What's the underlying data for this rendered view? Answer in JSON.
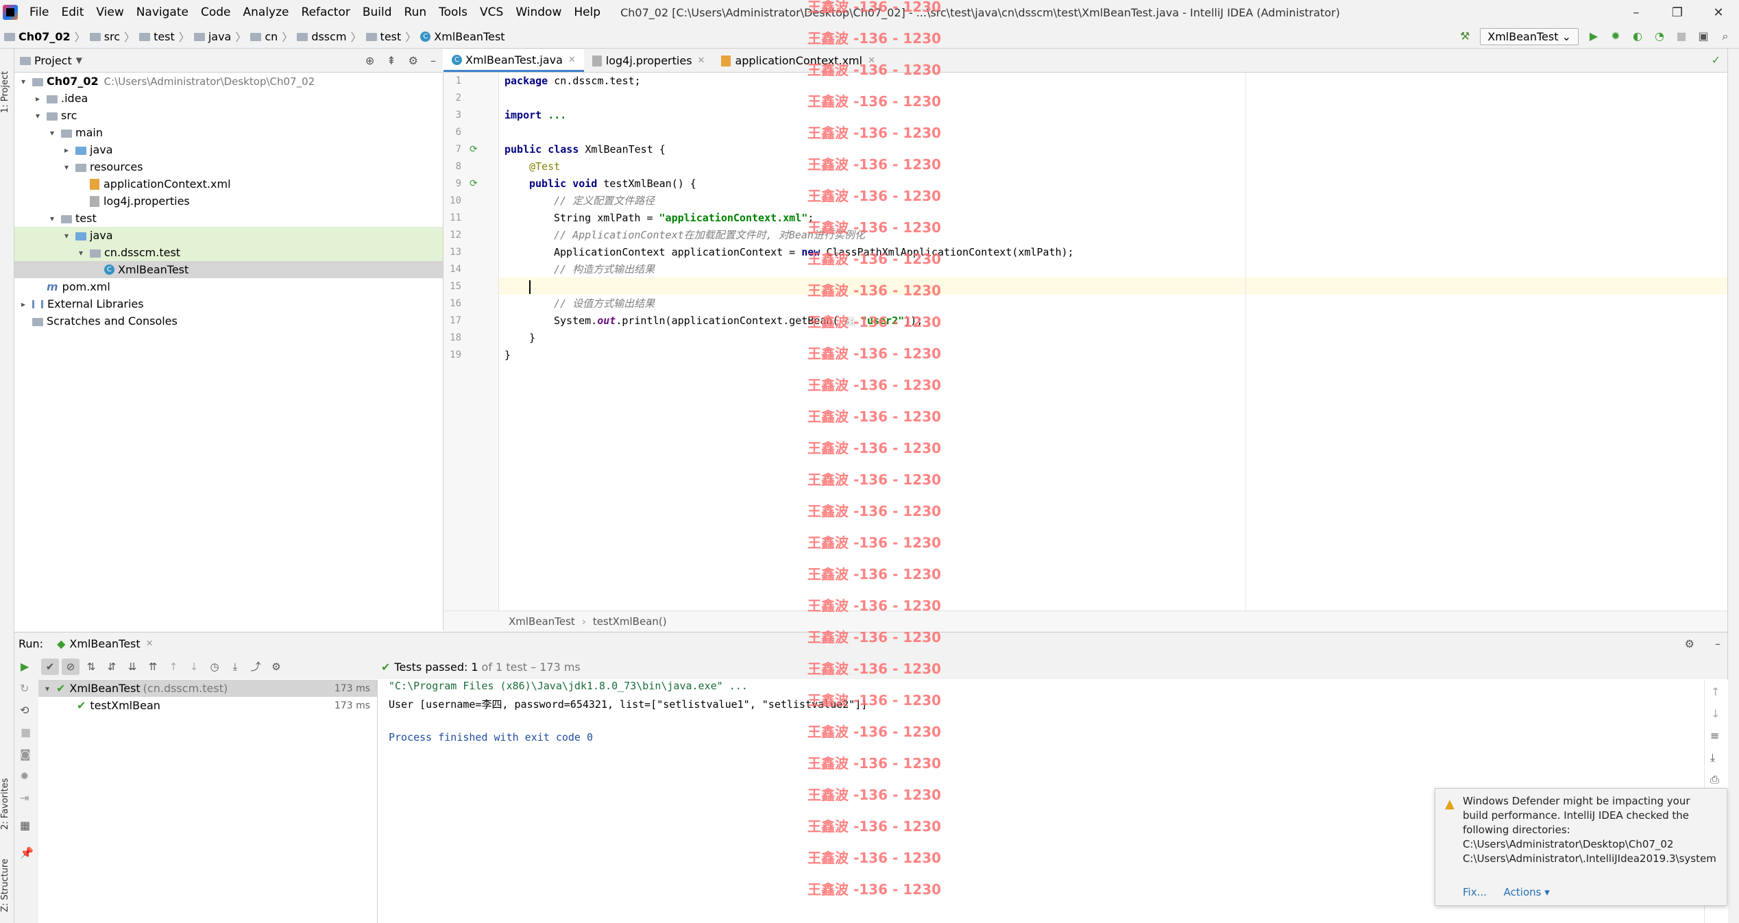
{
  "menubar": {
    "items": [
      "File",
      "Edit",
      "View",
      "Navigate",
      "Code",
      "Analyze",
      "Refactor",
      "Build",
      "Run",
      "Tools",
      "VCS",
      "Window",
      "Help"
    ],
    "window_title": "Ch07_02 [C:\\Users\\Administrator\\Desktop\\Ch07_02] - ...\\src\\test\\java\\cn\\dsscm\\test\\XmlBeanTest.java - IntelliJ IDEA (Administrator)",
    "controls": [
      "–",
      "❐",
      "✕"
    ]
  },
  "navbar": {
    "crumbs": [
      "Ch07_02",
      "src",
      "test",
      "java",
      "cn",
      "dsscm",
      "test",
      "XmlBeanTest"
    ],
    "run_config": "XmlBeanTest"
  },
  "left_stripe": {
    "project": "1: Project",
    "favorites": "2: Favorites",
    "structure": "Z: Structure"
  },
  "project_panel": {
    "title": "Project",
    "tree": [
      {
        "label": "Ch07_02",
        "extra": "C:\\Users\\Administrator\\Desktop\\Ch07_02",
        "depth": 0,
        "arrow": "▾",
        "icon": "folder",
        "bold": true
      },
      {
        "label": ".idea",
        "depth": 1,
        "arrow": "▸",
        "icon": "folder"
      },
      {
        "label": "src",
        "depth": 1,
        "arrow": "▾",
        "icon": "folder"
      },
      {
        "label": "main",
        "depth": 2,
        "arrow": "▾",
        "icon": "folder"
      },
      {
        "label": "java",
        "depth": 3,
        "arrow": "▸",
        "icon": "folder-blue"
      },
      {
        "label": "resources",
        "depth": 3,
        "arrow": "▾",
        "icon": "folder"
      },
      {
        "label": "applicationContext.xml",
        "depth": 4,
        "arrow": "",
        "icon": "xml"
      },
      {
        "label": "log4j.properties",
        "depth": 4,
        "arrow": "",
        "icon": "properties"
      },
      {
        "label": "test",
        "depth": 2,
        "arrow": "▾",
        "icon": "folder"
      },
      {
        "label": "java",
        "depth": 3,
        "arrow": "▾",
        "icon": "folder-blue",
        "state": "hl"
      },
      {
        "label": "cn.dsscm.test",
        "depth": 4,
        "arrow": "▾",
        "icon": "folder",
        "state": "hl"
      },
      {
        "label": "XmlBeanTest",
        "depth": 5,
        "arrow": "",
        "icon": "class",
        "state": "sel"
      },
      {
        "label": "pom.xml",
        "depth": 1,
        "arrow": "",
        "icon": "maven"
      },
      {
        "label": "External Libraries",
        "depth": 0,
        "arrow": "▸",
        "icon": "library"
      },
      {
        "label": "Scratches and Consoles",
        "depth": 0,
        "arrow": "",
        "icon": "scratch"
      }
    ]
  },
  "editor": {
    "tabs": [
      {
        "label": "XmlBeanTest.java",
        "active": true
      },
      {
        "label": "log4j.properties",
        "active": false
      },
      {
        "label": "applicationContext.xml",
        "active": false
      }
    ],
    "line_numbers": [
      "1",
      "2",
      "3",
      "6",
      "7",
      "8",
      "9",
      "10",
      "11",
      "12",
      "13",
      "14",
      "15",
      "16",
      "17",
      "18",
      "19"
    ],
    "code": {
      "l1_kw": "package",
      "l1_rest": " cn.dsscm.test;",
      "l3_kw": "import",
      "l3_rest": " ...",
      "l7_kw": "public class",
      "l7_rest": " XmlBeanTest {",
      "l8_an": "@Test",
      "l9_kw": "public void",
      "l9_rest": " testXmlBean() {",
      "l10_cm": "// 定义配置文件路径",
      "l11_a": "String xmlPath = ",
      "l11_str": "\"applicationContext.xml\"",
      "l11_b": ";",
      "l12_cm": "// ApplicationContext在加载配置文件时, 对Bean进行实例化",
      "l13_a": "ApplicationContext applicationContext = ",
      "l13_kw": "new",
      "l13_b": " ClassPathXmlApplicationContext(xmlPath);",
      "l14_cm": "// 构造方式输出结果",
      "l16_cm": "// 设值方式输出结果",
      "l17_a": "System.",
      "l17_fld": "out",
      "l17_b": ".println(applicationContext.getBean( ",
      "l17_hint": "s:",
      "l17_str": " \"user2\"",
      "l17_c": "));",
      "l18": "}",
      "l19": "}"
    },
    "breadcrumb": [
      "XmlBeanTest",
      "testXmlBean()"
    ]
  },
  "run": {
    "label": "Run:",
    "tab": "XmlBeanTest",
    "status_bold": "Tests passed:",
    "status_count": "1",
    "status_rest": "of 1 test – 173 ms",
    "tree": [
      {
        "label": "XmlBeanTest",
        "extra": "(cn.dsscm.test)",
        "ms": "173 ms"
      },
      {
        "label": "testXmlBean",
        "extra": "",
        "ms": "173 ms"
      }
    ],
    "console": [
      "\"C:\\Program Files (x86)\\Java\\jdk1.8.0_73\\bin\\java.exe\" ...",
      "User [username=李四, password=654321, list=[\"setlistvalue1\", \"setlistvalue2\"]]",
      "",
      "Process finished with exit code 0"
    ]
  },
  "notification": {
    "message": "Windows Defender might be impacting your build performance. IntelliJ IDEA checked the following directories:",
    "dir1": "C:\\Users\\Administrator\\Desktop\\Ch07_02",
    "dir2": "C:\\Users\\Administrator\\.IntelliJIdea2019.3\\system",
    "fix": "Fix...",
    "actions": "Actions ▾"
  },
  "watermark": "王鑫波 -136 - 1230",
  "colors": {
    "accent": "#4083c9",
    "pass": "#3f9c35",
    "watermark": "#ff6e6e",
    "current_line": "#fffae3"
  }
}
